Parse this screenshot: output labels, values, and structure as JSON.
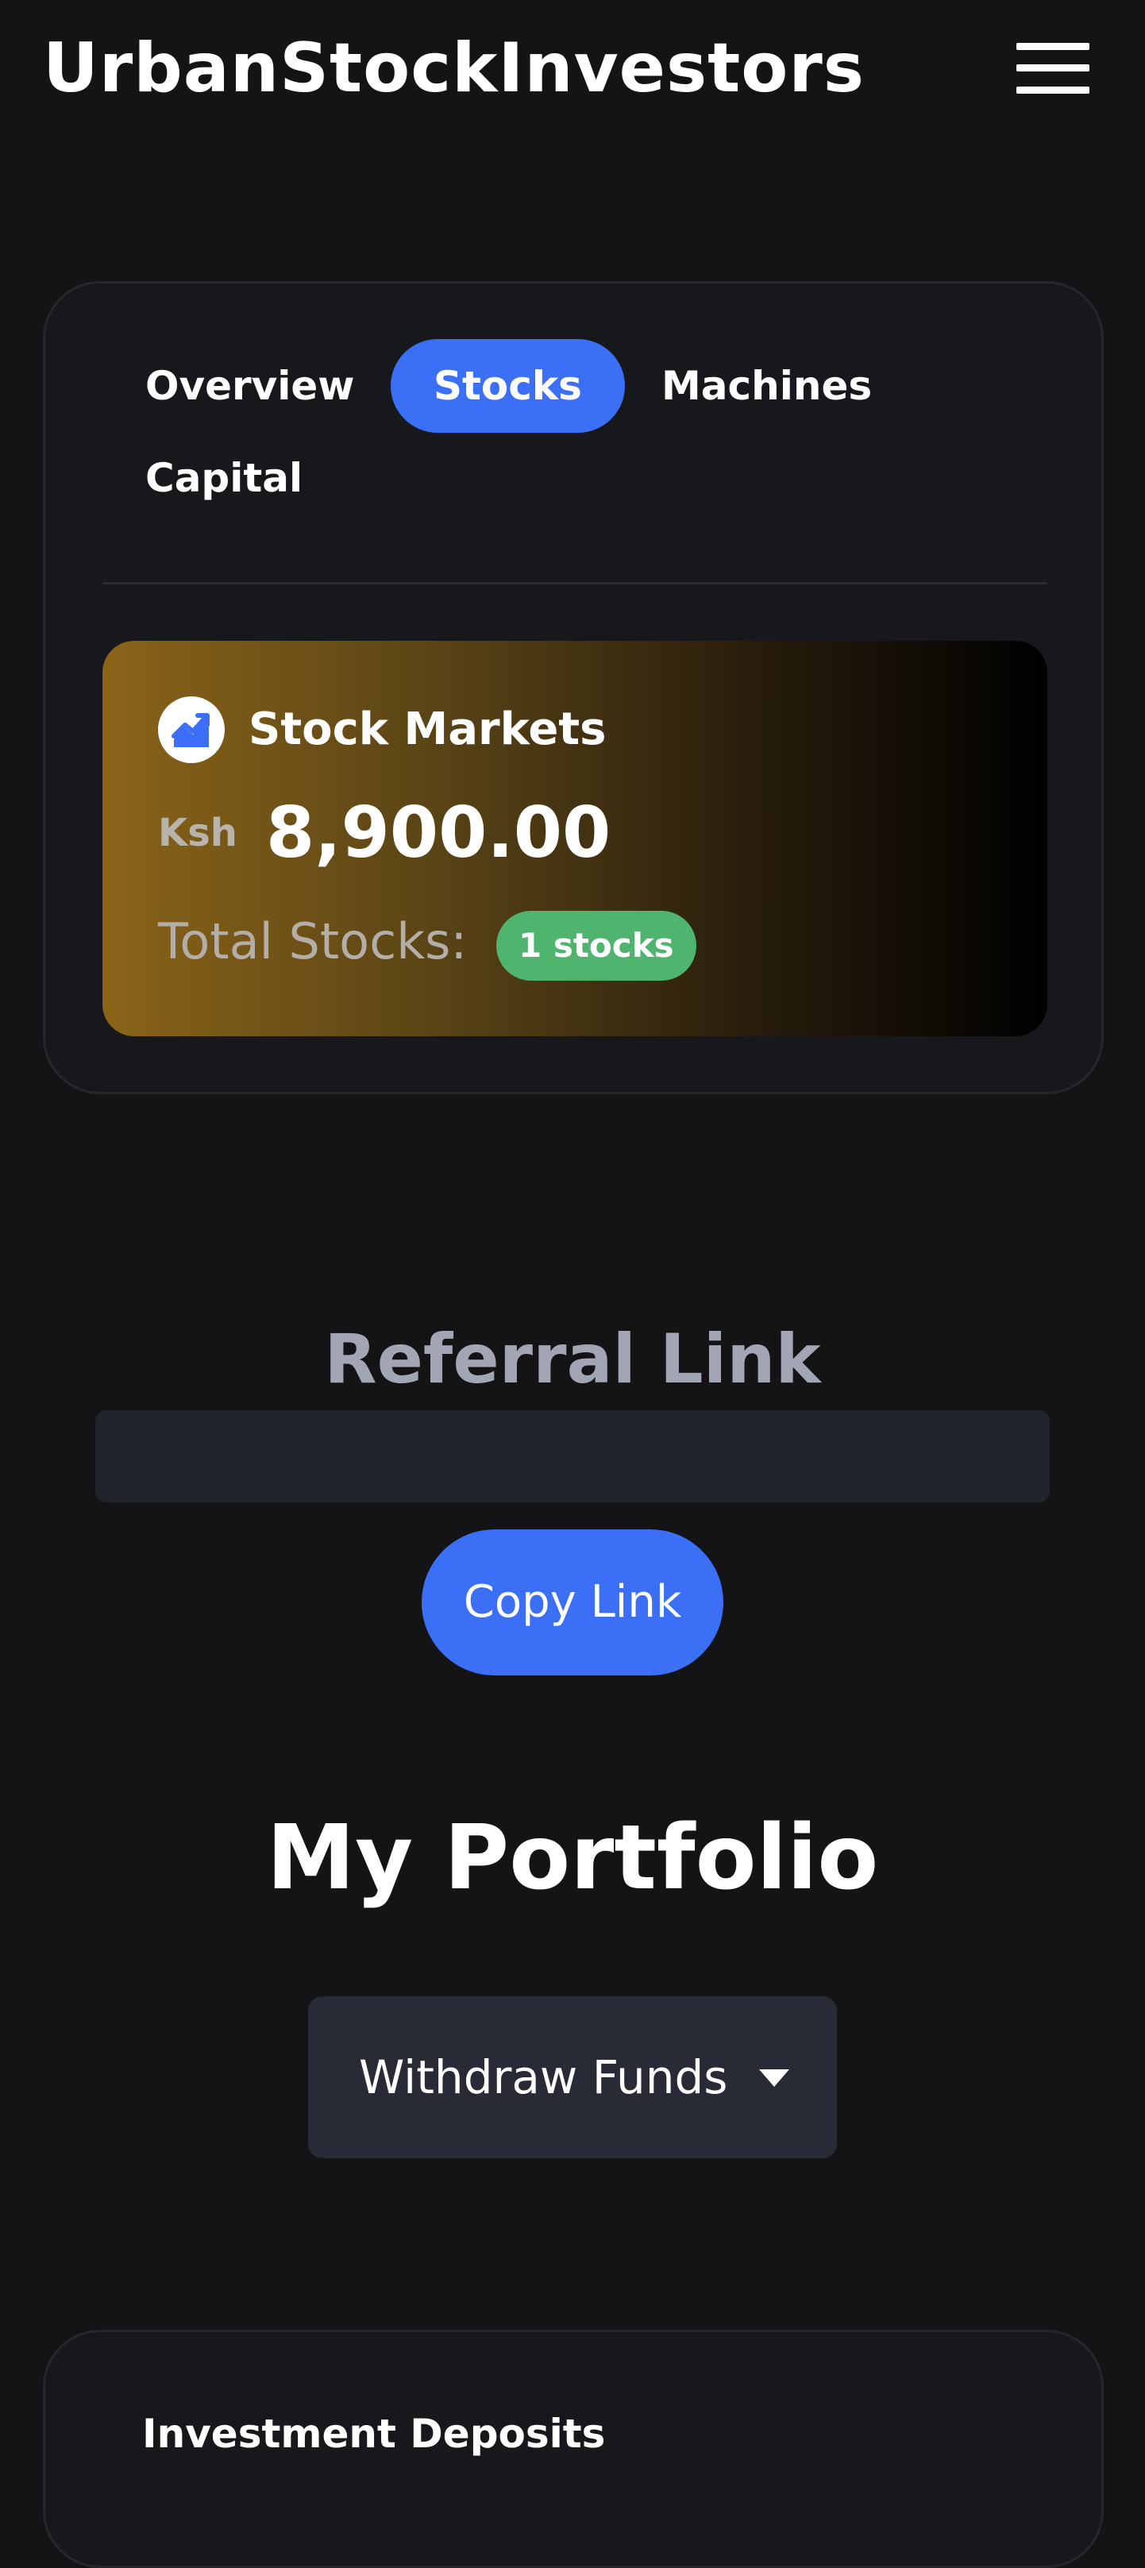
{
  "header": {
    "brand": "UrbanStockInvestors",
    "menu_icon": "hamburger-menu-icon"
  },
  "tabs": [
    {
      "label": "Overview",
      "active": false
    },
    {
      "label": "Stocks",
      "active": true
    },
    {
      "label": "Machines",
      "active": false
    },
    {
      "label": "Capital",
      "active": false
    }
  ],
  "market": {
    "icon": "trending-up-chart-icon",
    "title": "Stock Markets",
    "currency": "Ksh",
    "amount": "8,900.00",
    "total_label": "Total Stocks:",
    "badge": "1 stocks"
  },
  "referral": {
    "title": "Referral Link",
    "value": "",
    "copy_label": "Copy Link"
  },
  "portfolio": {
    "title": "My Portfolio",
    "withdraw_label": "Withdraw Funds",
    "caret_icon": "caret-down-icon"
  },
  "deposits": {
    "title": "Investment Deposits"
  },
  "colors": {
    "background": "#141416",
    "card": "#17181c",
    "accent": "#3b6ff6",
    "badge": "#4fb46e",
    "gold": "#8a6418",
    "muted": "#a2a5b3"
  }
}
